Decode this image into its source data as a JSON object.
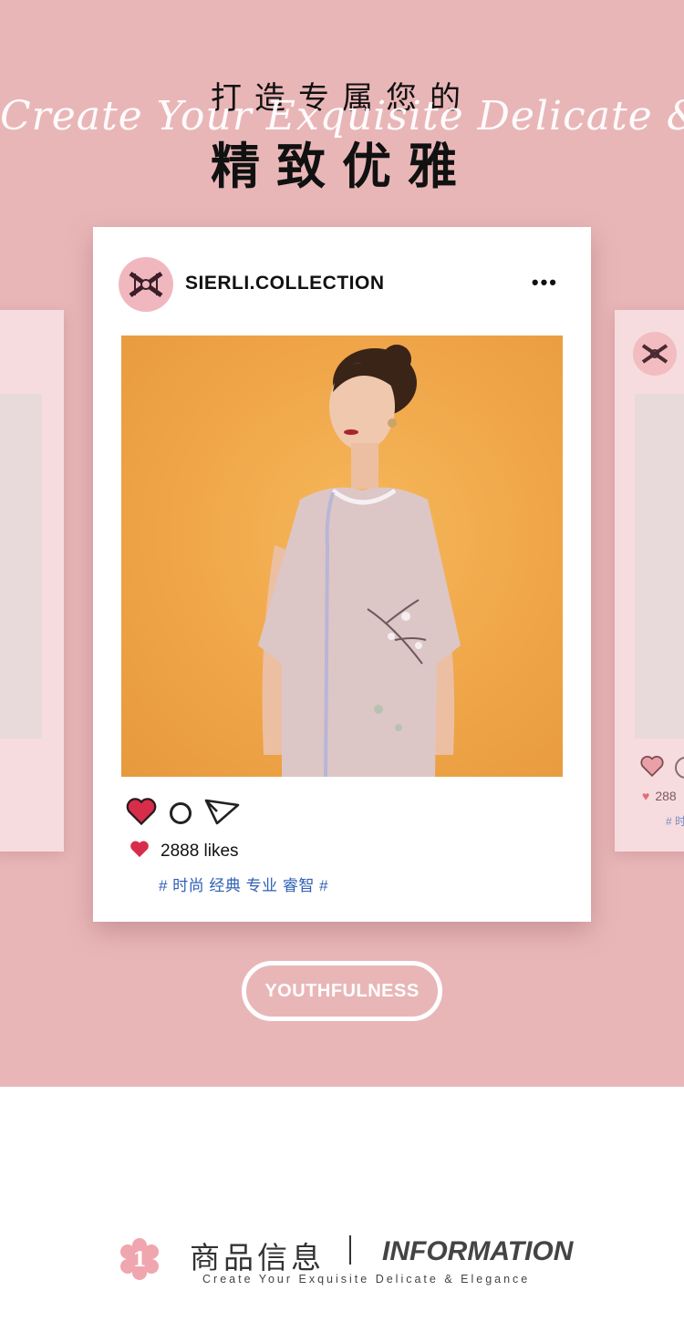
{
  "header": {
    "title_line1": "打造专属您的",
    "script_text": "Create Your Exquisite Delicate & Elegance",
    "title_line2": "精致优雅"
  },
  "post": {
    "account_name": "SIERLI.COLLECTION",
    "more_label": "•••",
    "likes_text": "2888 likes",
    "hashtags": "# 时尚 经典 专业 睿智 #",
    "liked": true
  },
  "side_card_right": {
    "likes_partial": "288",
    "tag_partial": "# 时"
  },
  "badge": {
    "label": "YOUTHFULNESS"
  },
  "info_section": {
    "number": "1",
    "title_cn": "商品信息",
    "title_en": "INFORMATION",
    "subtitle": "Create Your Exquisite Delicate & Elegance"
  },
  "colors": {
    "hero_background": "#e9b6b8",
    "heart_red": "#d72d4b",
    "hashtag_blue": "#2f5fb5",
    "accent_pink": "#f0b8be"
  }
}
